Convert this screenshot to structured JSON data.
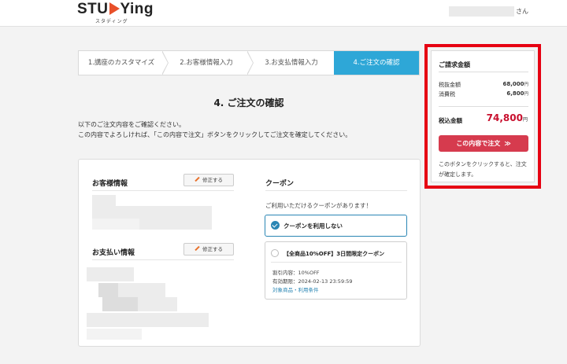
{
  "header": {
    "logo_text_left": "STU",
    "logo_text_right": "Ying",
    "logo_sub": "スタディング",
    "user_suffix": "さん"
  },
  "steps": [
    {
      "label": "1.講座のカスタマイズ",
      "active": false
    },
    {
      "label": "2.お客様情報入力",
      "active": false
    },
    {
      "label": "3.お支払情報入力",
      "active": false
    },
    {
      "label": "4.ご注文の確認",
      "active": true
    }
  ],
  "page": {
    "title": "4. ご注文の確認",
    "intro_line1": "以下のご注文内容をご確認ください。",
    "intro_line2": "この内容でよろしければ、「この内容で注文」ボタンをクリックしてご注文を確定してください。"
  },
  "customer": {
    "heading": "お客様情報",
    "edit_label": "修正する"
  },
  "payment": {
    "heading": "お支払い情報",
    "edit_label": "修正する"
  },
  "coupon": {
    "heading": "クーポン",
    "note": "ご利用いただけるクーポンがあります！",
    "none_label": "クーポンを利用しない",
    "offer_title": "【全商品10%OFF】3日間限定クーポン",
    "offer_discount": "割引内容：10%OFF",
    "offer_expiry": "有効期限：2024-02-13 23:59:59",
    "offer_link": "対象商品・利用条件"
  },
  "summary": {
    "title": "ご請求金額",
    "subtotal_label": "税抜金額",
    "subtotal_value": "68,000",
    "tax_label": "消費税",
    "tax_value": "6,800",
    "yen": "円",
    "total_label": "税込金額",
    "total_value": "74,800",
    "order_button": "この内容で注文",
    "order_arrows": "≫",
    "note": "このボタンをクリックすると、注文が確定します。"
  },
  "colors": {
    "accent": "#2ea7d7",
    "order_button": "#d63b4e",
    "highlight_border": "#e60012",
    "total": "#c8102e"
  }
}
